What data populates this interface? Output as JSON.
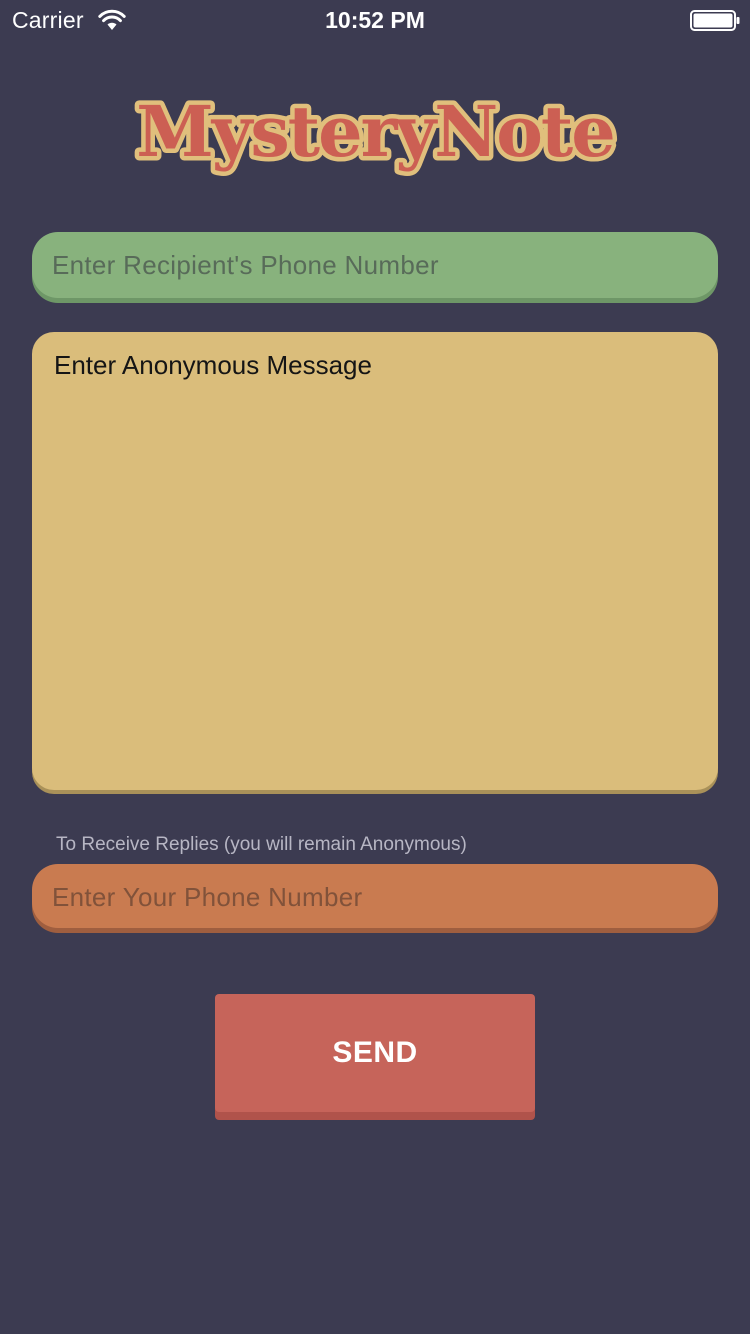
{
  "status_bar": {
    "carrier": "Carrier",
    "time": "10:52 PM",
    "wifi_icon": "wifi-icon",
    "battery_icon": "battery-full-icon"
  },
  "logo": {
    "text": "MysteryNote",
    "fill_color": "#cc5f53",
    "outline_color": "#e0bf7c"
  },
  "form": {
    "recipient_placeholder": "Enter Recipient's Phone Number",
    "message_placeholder": "Enter Anonymous Message",
    "reply_hint": "To Receive Replies (you will remain Anonymous)",
    "reply_placeholder": "Enter Your Phone Number",
    "send_label": "SEND"
  },
  "colors": {
    "background": "#3c3b51",
    "recipient_field": "#88b27d",
    "message_field": "#dabd7b",
    "reply_field": "#c97b50",
    "send_button": "#c6645a"
  }
}
